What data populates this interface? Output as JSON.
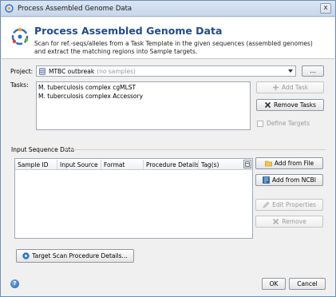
{
  "window": {
    "title": "Process Assembled Genome Data",
    "close_glyph": "x"
  },
  "header": {
    "title": "Process Assembled Genome Data",
    "description": "Scan for ref.-seqs/alleles from a Task Template in the given sequences (assembled genomes) and extract the matching regions into Sample targets."
  },
  "project": {
    "label": "Project:",
    "value": "MTBC outbreak",
    "value_suffix": "(no samples)",
    "browse_label": "..."
  },
  "tasks": {
    "label": "Tasks:",
    "items": [
      "M. tuberculosis complex cgMLST",
      "M. tuberculosis complex Accessory"
    ],
    "add_label": "Add Task",
    "remove_label": "Remove Tasks",
    "define_targets_label": "Define Targets"
  },
  "input_sequences": {
    "section_label": "Input Sequence Data",
    "columns": [
      "Sample ID",
      "Input Source",
      "Format",
      "Procedure Details",
      "Tag(s)"
    ],
    "add_file_label": "Add from File",
    "add_ncbi_label": "Add from NCBI",
    "edit_label": "Edit Properties",
    "remove_label": "Remove"
  },
  "procedure_button_label": "Target Scan Procedure Details...",
  "footer": {
    "ok_label": "OK",
    "cancel_label": "Cancel",
    "help_glyph": "?"
  },
  "colors": {
    "title_blue": "#1f4b8f",
    "disabled_text": "#9a9a9a",
    "remove_red": "#c0392b"
  },
  "icons": [
    "app-icon",
    "genome-logo-icon",
    "database-icon",
    "add-icon",
    "remove-icon",
    "folder-icon",
    "ncbi-icon",
    "edit-icon",
    "remove-disabled-icon",
    "procedure-icon",
    "help-icon",
    "column-chooser-icon"
  ]
}
